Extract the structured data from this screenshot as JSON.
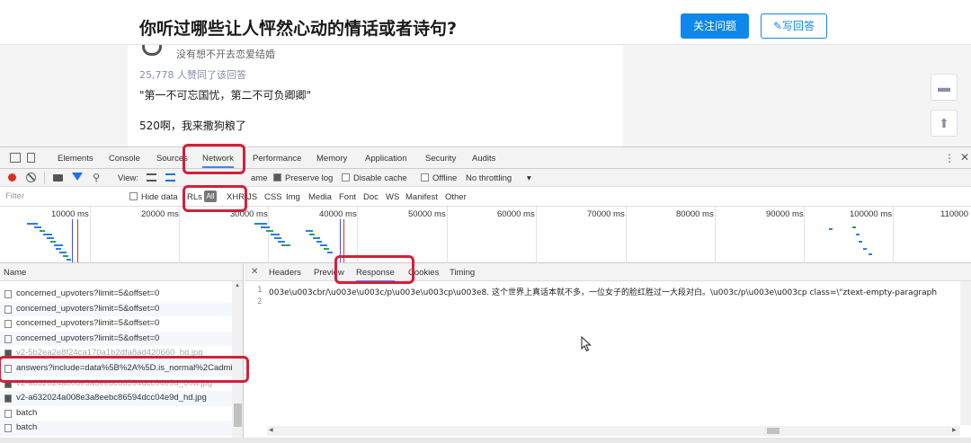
{
  "page": {
    "question_title": "你听过哪些让人怦然心动的情话或者诗句?",
    "follow_button": "关注问题",
    "write_answer_button": "✎写回答",
    "author_motto": "没有想不开去恋爱结婚",
    "votes_text": "25,778 人赞同了该回答",
    "answer_line1": "\"第一不可忘国忧，第二不可负卿卿\"",
    "answer_line2": "520啊，我来撒狗粮了"
  },
  "devtools": {
    "tabs": [
      "Elements",
      "Console",
      "Sources",
      "Network",
      "Performance",
      "Memory",
      "Application",
      "Security",
      "Audits"
    ],
    "active_tab": "Network",
    "toolbar": {
      "view_label": "View:",
      "group_label": "ame",
      "preserve_log": "Preserve log",
      "disable_cache": "Disable cache",
      "offline": "Offline",
      "throttling": "No throttling"
    },
    "filterbar": {
      "placeholder": "Filter",
      "hide_data": "Hide data",
      "rls": "RLs",
      "all": "All",
      "types": [
        "XHR",
        "JS",
        "CSS",
        "Img",
        "Media",
        "Font",
        "Doc",
        "WS",
        "Manifest",
        "Other"
      ]
    },
    "timeline": {
      "ticks": [
        "10000 ms",
        "20000 ms",
        "30000 ms",
        "40000 ms",
        "50000 ms",
        "60000 ms",
        "70000 ms",
        "80000 ms",
        "90000 ms",
        "100000 ms",
        "110000"
      ]
    },
    "requests": {
      "header": "Name",
      "rows": [
        {
          "name": "concerned_upvoters?limit=5&offset=0",
          "kind": "doc"
        },
        {
          "name": "concerned_upvoters?limit=5&offset=0",
          "kind": "doc"
        },
        {
          "name": "concerned_upvoters?limit=5&offset=0",
          "kind": "doc"
        },
        {
          "name": "concerned_upvoters?limit=5&offset=0",
          "kind": "doc"
        },
        {
          "name": "v2-5b2ea2e8f24ca170a1b2dfa8ad420660_hd.jpg",
          "kind": "img"
        },
        {
          "name": "answers?include=data%5B%2A%5D.is_normal%2Cadmin",
          "kind": "doc"
        },
        {
          "name": "v2-a632024a008e3a8eebc86594dcc04e9d_60w.jpg",
          "kind": "img"
        },
        {
          "name": "v2-a632024a008e3a8eebc86594dcc04e9d_hd.jpg",
          "kind": "img"
        },
        {
          "name": "batch",
          "kind": "doc"
        },
        {
          "name": "batch",
          "kind": "doc"
        }
      ]
    },
    "detail": {
      "tabs": [
        "Headers",
        "Preview",
        "Response",
        "Cookies",
        "Timing"
      ],
      "active_tab": "Response",
      "line_numbers": [
        "1",
        "2"
      ],
      "response_text": "003e\\u003cbr/\\u003e\\u003c/p\\u003e\\u003cp\\u003e8. 这个世界上真话本就不多，一位女子的脸红胜过一大段对白。\\u003c/p\\u003e\\u003cp class=\\\"ztext-empty-paragraph"
    }
  },
  "colors": {
    "accent_blue": "#0f88eb",
    "highlight_red": "#d3203a",
    "record_red": "#d93025"
  }
}
